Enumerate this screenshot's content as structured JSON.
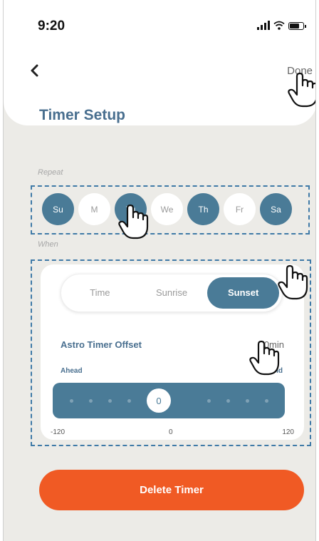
{
  "status_bar": {
    "time": "9:20"
  },
  "header": {
    "back_label": "<",
    "done_label": "Done",
    "title": "Timer Setup"
  },
  "repeat": {
    "label": "Repeat",
    "days": [
      {
        "label": "Su",
        "selected": true
      },
      {
        "label": "M",
        "selected": false
      },
      {
        "label": "Tu",
        "selected": true
      },
      {
        "label": "We",
        "selected": false
      },
      {
        "label": "Th",
        "selected": true
      },
      {
        "label": "Fr",
        "selected": false
      },
      {
        "label": "Sa",
        "selected": true
      }
    ]
  },
  "when": {
    "label": "When",
    "modes": [
      "Time",
      "Sunrise",
      "Sunset"
    ],
    "selected_mode": "Sunset",
    "offset_title": "Astro Timer Offset",
    "offset_value": "0min",
    "ahead_label": "Ahead",
    "behind_label": "Behind",
    "slider": {
      "min": -120,
      "max": 120,
      "value": 0,
      "value_label": "0",
      "min_label": "-120",
      "mid_label": "0",
      "max_label": "120"
    }
  },
  "delete_label": "Delete Timer",
  "colors": {
    "accent": "#4a7b97",
    "title": "#496f8f",
    "delete": "#f05a24",
    "background": "#ecebe7"
  }
}
